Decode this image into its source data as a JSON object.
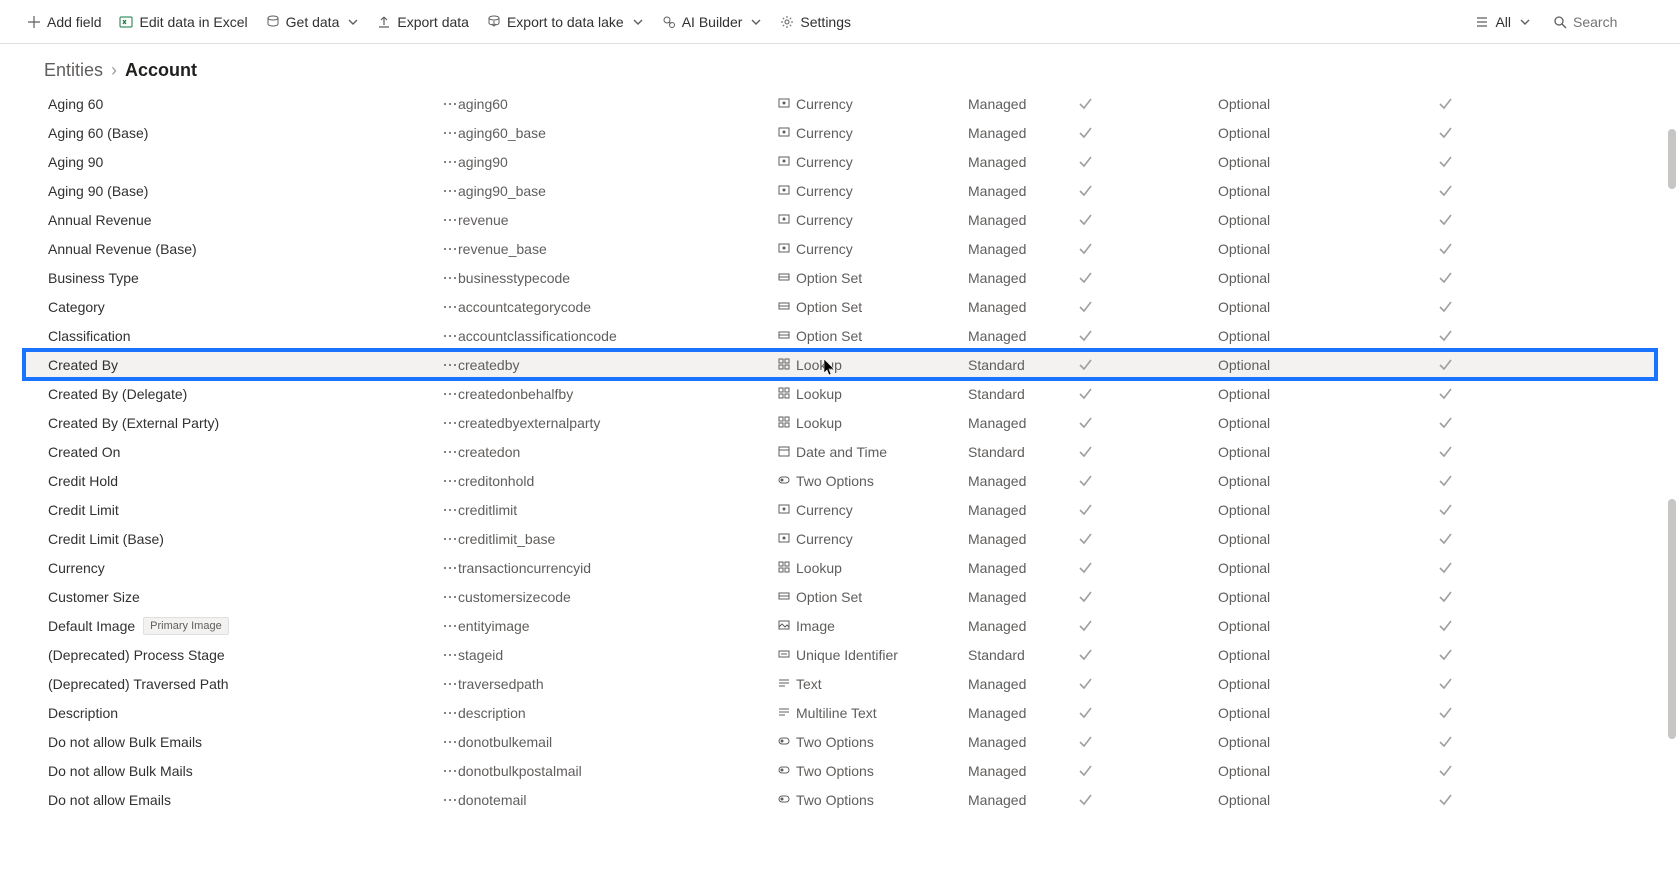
{
  "toolbar": {
    "add_field": "Add field",
    "edit_excel": "Edit data in Excel",
    "get_data": "Get data",
    "export_data": "Export data",
    "export_lake": "Export to data lake",
    "ai_builder": "AI Builder",
    "settings": "Settings",
    "all": "All",
    "search_placeholder": "Search"
  },
  "breadcrumb": {
    "root": "Entities",
    "current": "Account"
  },
  "labels": {
    "primary_image_badge": "Primary Image"
  },
  "rows": [
    {
      "display": "Aging 60",
      "name": "aging60",
      "type": "Currency",
      "mode": "Managed",
      "req": "Optional"
    },
    {
      "display": "Aging 60 (Base)",
      "name": "aging60_base",
      "type": "Currency",
      "mode": "Managed",
      "req": "Optional"
    },
    {
      "display": "Aging 90",
      "name": "aging90",
      "type": "Currency",
      "mode": "Managed",
      "req": "Optional"
    },
    {
      "display": "Aging 90 (Base)",
      "name": "aging90_base",
      "type": "Currency",
      "mode": "Managed",
      "req": "Optional"
    },
    {
      "display": "Annual Revenue",
      "name": "revenue",
      "type": "Currency",
      "mode": "Managed",
      "req": "Optional"
    },
    {
      "display": "Annual Revenue (Base)",
      "name": "revenue_base",
      "type": "Currency",
      "mode": "Managed",
      "req": "Optional"
    },
    {
      "display": "Business Type",
      "name": "businesstypecode",
      "type": "Option Set",
      "mode": "Managed",
      "req": "Optional"
    },
    {
      "display": "Category",
      "name": "accountcategorycode",
      "type": "Option Set",
      "mode": "Managed",
      "req": "Optional"
    },
    {
      "display": "Classification",
      "name": "accountclassificationcode",
      "type": "Option Set",
      "mode": "Managed",
      "req": "Optional"
    },
    {
      "display": "Created By",
      "name": "createdby",
      "type": "Lookup",
      "mode": "Standard",
      "req": "Optional",
      "highlighted": true,
      "cursor": true
    },
    {
      "display": "Created By (Delegate)",
      "name": "createdonbehalfby",
      "type": "Lookup",
      "mode": "Standard",
      "req": "Optional"
    },
    {
      "display": "Created By (External Party)",
      "name": "createdbyexternalparty",
      "type": "Lookup",
      "mode": "Managed",
      "req": "Optional"
    },
    {
      "display": "Created On",
      "name": "createdon",
      "type": "Date and Time",
      "mode": "Standard",
      "req": "Optional"
    },
    {
      "display": "Credit Hold",
      "name": "creditonhold",
      "type": "Two Options",
      "mode": "Managed",
      "req": "Optional"
    },
    {
      "display": "Credit Limit",
      "name": "creditlimit",
      "type": "Currency",
      "mode": "Managed",
      "req": "Optional"
    },
    {
      "display": "Credit Limit (Base)",
      "name": "creditlimit_base",
      "type": "Currency",
      "mode": "Managed",
      "req": "Optional"
    },
    {
      "display": "Currency",
      "name": "transactioncurrencyid",
      "type": "Lookup",
      "mode": "Managed",
      "req": "Optional"
    },
    {
      "display": "Customer Size",
      "name": "customersizecode",
      "type": "Option Set",
      "mode": "Managed",
      "req": "Optional"
    },
    {
      "display": "Default Image",
      "name": "entityimage",
      "type": "Image",
      "mode": "Managed",
      "req": "Optional",
      "badge": "primary_image_badge"
    },
    {
      "display": "(Deprecated) Process Stage",
      "name": "stageid",
      "type": "Unique Identifier",
      "mode": "Standard",
      "req": "Optional"
    },
    {
      "display": "(Deprecated) Traversed Path",
      "name": "traversedpath",
      "type": "Text",
      "mode": "Managed",
      "req": "Optional"
    },
    {
      "display": "Description",
      "name": "description",
      "type": "Multiline Text",
      "mode": "Managed",
      "req": "Optional"
    },
    {
      "display": "Do not allow Bulk Emails",
      "name": "donotbulkemail",
      "type": "Two Options",
      "mode": "Managed",
      "req": "Optional"
    },
    {
      "display": "Do not allow Bulk Mails",
      "name": "donotbulkpostalmail",
      "type": "Two Options",
      "mode": "Managed",
      "req": "Optional"
    },
    {
      "display": "Do not allow Emails",
      "name": "donotemail",
      "type": "Two Options",
      "mode": "Managed",
      "req": "Optional"
    }
  ]
}
